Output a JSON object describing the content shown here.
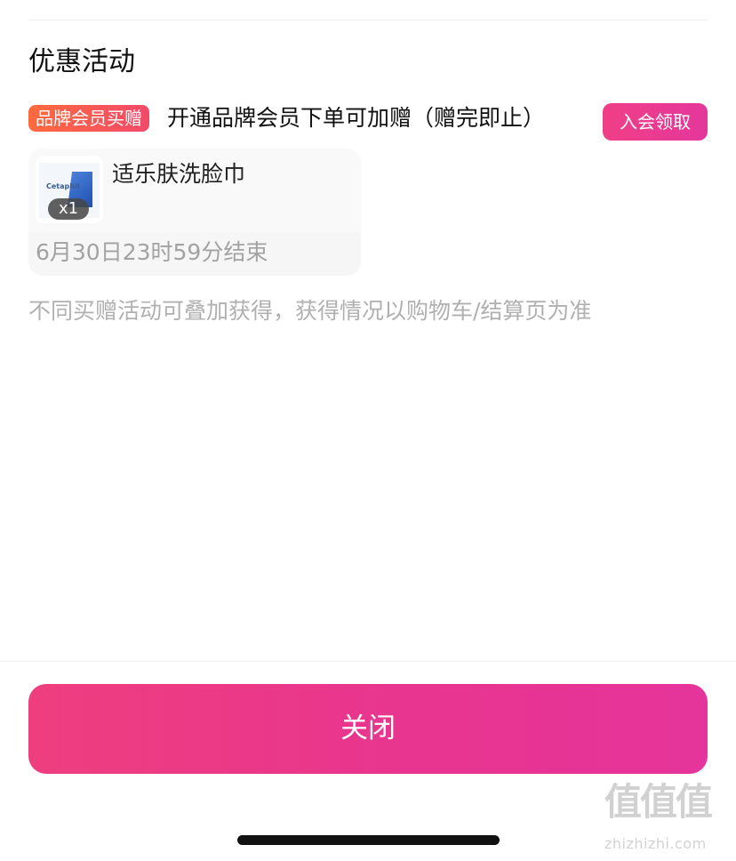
{
  "section": {
    "title": "优惠活动"
  },
  "promo": {
    "badge": "品牌会员买赠",
    "description": "开通品牌会员下单可加赠（赠完即止）",
    "join_button": "入会领取"
  },
  "gift": {
    "thumbnail_brand": "Cetaphil",
    "quantity": "x1",
    "name": "适乐肤洗脸巾",
    "end_time": "6月30日23时59分结束"
  },
  "note": {
    "text": "不同买赠活动可叠加获得，获得情况以购物车/结算页为准"
  },
  "footer": {
    "close_button": "关闭"
  },
  "watermark": {
    "logo": "值值值",
    "url": "zhizhizhi.com"
  },
  "colors": {
    "accent": "#E9378F",
    "promo_badge": "#F24A6A",
    "secondary_text": "#A2A2A2"
  }
}
